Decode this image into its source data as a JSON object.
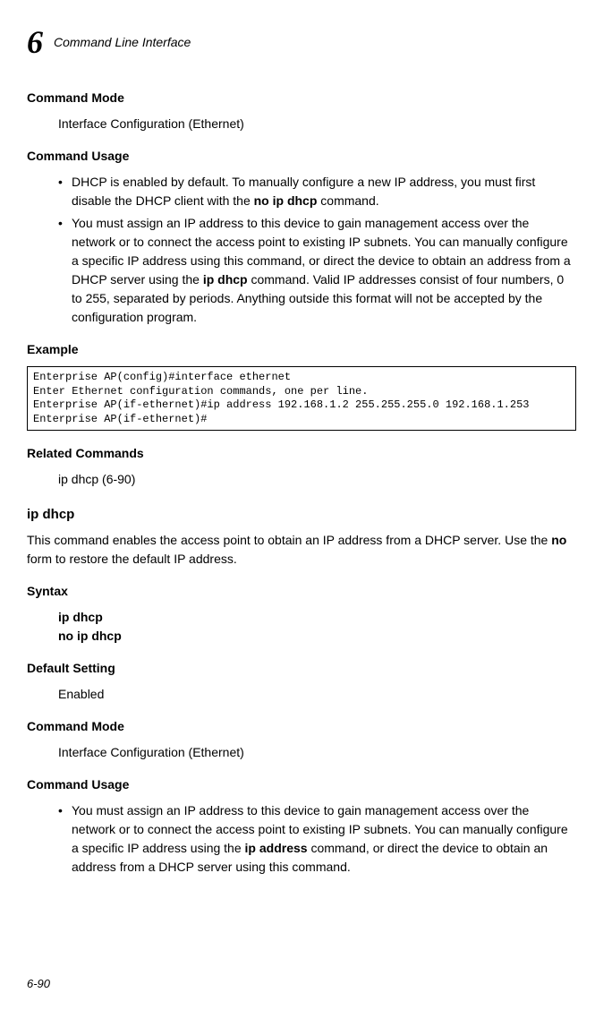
{
  "header": {
    "chapter_number": "6",
    "chapter_title": "Command Line Interface"
  },
  "section1": {
    "cmdmode_heading": "Command Mode",
    "cmdmode_text": "Interface Configuration (Ethernet)",
    "cmdusage_heading": "Command Usage",
    "bullet1_pre": "DHCP is enabled by default. To manually configure a new IP address, you must first disable the DHCP client with the ",
    "bullet1_bold": "no ip dhcp",
    "bullet1_post": " command.",
    "bullet2_pre": "You must assign an IP address to this device to gain management access over the network or to connect the access point to existing IP subnets. You can manually configure a specific IP address using this command, or direct the device to obtain an address from a DHCP server using the ",
    "bullet2_bold": "ip dhcp",
    "bullet2_post": " command. Valid IP addresses consist of four numbers, 0 to 255, separated by periods. Anything outside this format will not be accepted by the configuration program.",
    "example_heading": "Example",
    "code": "Enterprise AP(config)#interface ethernet\nEnter Ethernet configuration commands, one per line.\nEnterprise AP(if-ethernet)#ip address 192.168.1.2 255.255.255.0 192.168.1.253\nEnterprise AP(if-ethernet)#",
    "related_heading": "Related Commands",
    "related_text": "ip dhcp (6-90)"
  },
  "section2": {
    "cmd_name": "ip dhcp",
    "desc_pre": "This command enables the access point to obtain an IP address from a DHCP server. Use the ",
    "desc_bold": "no",
    "desc_post": " form to restore the default IP address.",
    "syntax_heading": "Syntax",
    "syntax_line1": "ip dhcp",
    "syntax_line2": "no ip dhcp",
    "default_heading": "Default Setting",
    "default_text": "Enabled",
    "cmdmode_heading": "Command Mode",
    "cmdmode_text": "Interface Configuration (Ethernet)",
    "cmdusage_heading": "Command Usage",
    "bullet1_pre": "You must assign an IP address to this device to gain management access over the network or to connect the access point to existing IP subnets. You can manually configure a specific IP address using the ",
    "bullet1_bold": "ip address",
    "bullet1_post": " command, or direct the device to obtain an address from a DHCP server using this command."
  },
  "footer": {
    "page_number": "6-90"
  }
}
